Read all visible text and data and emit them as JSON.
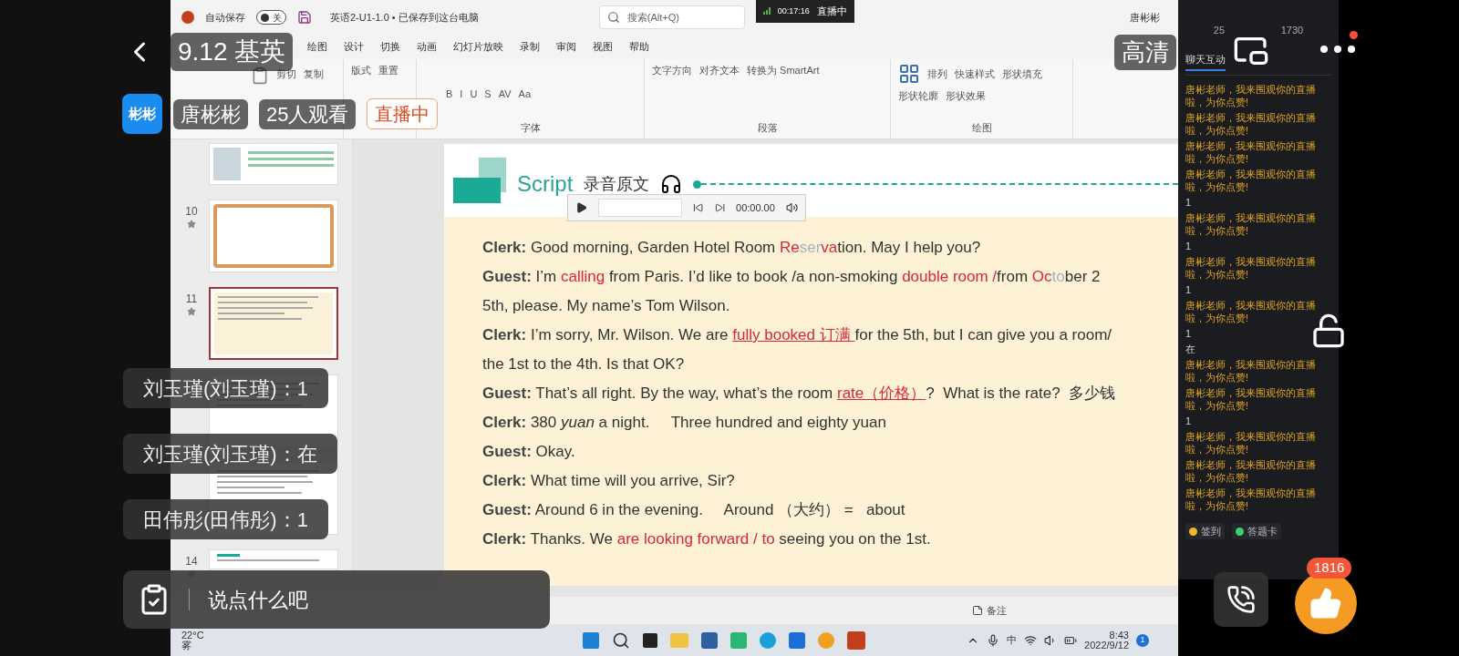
{
  "stream": {
    "title": "9.12 基英",
    "quality": "高清",
    "host_avatar": "彬彬",
    "host_name": "唐彬彬",
    "viewers": "25人观看",
    "live_badge": "直播中",
    "like_count": "1816"
  },
  "overlay_comments": [
    {
      "text": "刘玉瑾(刘玉瑾)：1"
    },
    {
      "text": "刘玉瑾(刘玉瑾)：在"
    },
    {
      "text": "田伟彤(田伟彤)：1"
    }
  ],
  "comment_input": {
    "placeholder": "说点什么吧"
  },
  "ppt": {
    "title_bar": {
      "autosave_label": "自动保存",
      "autosave_on": false,
      "toggle_text": "关",
      "filename": "英语2-U1-1.0 • 已保存到这台电脑",
      "search_placeholder": "搜索(Alt+Q)",
      "recording_time": "00:17:16",
      "recording_label": "直播中",
      "user": "唐彬彬"
    },
    "menu": [
      "绘图",
      "设计",
      "切换",
      "动画",
      "幻灯片放映",
      "录制",
      "审阅",
      "视图",
      "帮助"
    ],
    "ribbon_groups": [
      {
        "items": [
          "剪切",
          "复制"
        ]
      },
      {
        "items": [
          "版式",
          "重置"
        ]
      },
      {
        "label": "字体",
        "items": [
          "B",
          "I",
          "U",
          "S",
          "AV",
          "Aa"
        ]
      },
      {
        "label": "段落",
        "items": [
          "文字方向",
          "对齐文本",
          "转换为 SmartArt"
        ]
      },
      {
        "label": "绘图",
        "items": [
          "排列",
          "快速样式",
          "形状填充",
          "形状轮廓",
          "形状效果"
        ]
      }
    ],
    "thumbnails": [
      {
        "selected": false,
        "kind": "picture"
      },
      {
        "number": "10",
        "selected": false,
        "kind": "form"
      },
      {
        "number": "11",
        "selected": true,
        "kind": "text"
      },
      {
        "selected": false,
        "kind": "text"
      },
      {
        "selected": false,
        "kind": "text"
      },
      {
        "number": "14",
        "selected": false,
        "kind": "top"
      }
    ],
    "slide": {
      "heading": "Script",
      "heading_cn": "录音原文",
      "player_time": "00:00.00",
      "lines": [
        {
          "speaker": "Clerk:",
          "segments": [
            {
              "text": " Good morning, Garden Hotel Room ",
              "kind": "plain"
            },
            {
              "text": "Re",
              "kind": "red"
            },
            {
              "text": "ser",
              "kind": "faded"
            },
            {
              "text": "va",
              "kind": "red"
            },
            {
              "text": "tion. May I help you?",
              "kind": "plain"
            }
          ]
        },
        {
          "speaker": "Guest:",
          "segments": [
            {
              "text": " I’m ",
              "kind": "plain"
            },
            {
              "text": "calling",
              "kind": "red"
            },
            {
              "text": " from Paris. I’d like to book /a non-smoking ",
              "kind": "plain"
            },
            {
              "text": "double room /",
              "kind": "red"
            },
            {
              "text": "from ",
              "kind": "plain"
            },
            {
              "text": "Oc",
              "kind": "red"
            },
            {
              "text": "to",
              "kind": "faded"
            },
            {
              "text": "ber 2",
              "kind": "plain"
            }
          ]
        },
        {
          "segments": [
            {
              "text": "5th, please. My name’s Tom Wilson.",
              "kind": "plain"
            }
          ]
        },
        {
          "speaker": "Clerk:",
          "segments": [
            {
              "text": " I’m sorry, Mr. Wilson. We are ",
              "kind": "plain"
            },
            {
              "text": "fully booked 订满 ",
              "kind": "red_underline"
            },
            {
              "text": "for the 5th, but I can give you a room/",
              "kind": "plain"
            }
          ]
        },
        {
          "segments": [
            {
              "text": "the 1st to the 4th. Is that OK?",
              "kind": "plain"
            }
          ]
        },
        {
          "speaker": "Guest:",
          "segments": [
            {
              "text": " That’s all right. By the way, what’s the room ",
              "kind": "plain"
            },
            {
              "text": "rate（价格）",
              "kind": "red_underline"
            },
            {
              "text": "?  What is the rate?  多少钱",
              "kind": "plain"
            }
          ]
        },
        {
          "speaker": "Clerk:",
          "segments": [
            {
              "text": " 380 ",
              "kind": "plain"
            },
            {
              "text": "yuan",
              "kind": "italic"
            },
            {
              "text": " a night.     Three hundred and eighty yuan",
              "kind": "plain"
            }
          ]
        },
        {
          "speaker": "Guest:",
          "segments": [
            {
              "text": " Okay.",
              "kind": "plain"
            }
          ]
        },
        {
          "speaker": "Clerk:",
          "segments": [
            {
              "text": " What time will you arrive, Sir?",
              "kind": "plain"
            }
          ]
        },
        {
          "speaker": "Guest:",
          "segments": [
            {
              "text": " Around 6 in the evening.     Around （大约） =   about",
              "kind": "plain"
            }
          ]
        },
        {
          "speaker": "Clerk:",
          "segments": [
            {
              "text": " Thanks. We ",
              "kind": "plain"
            },
            {
              "text": "are looking forward / to",
              "kind": "red"
            },
            {
              "text": " seeing you on the 1st.",
              "kind": "plain"
            }
          ]
        }
      ]
    },
    "status_bar": {
      "notes": "备注"
    },
    "taskbar": {
      "weather_temp": "22°C",
      "weather_desc": "雾",
      "ime": "中",
      "time": "8:43",
      "date": "2022/9/12",
      "notification_count": "1"
    }
  },
  "chat_panel": {
    "stats": [
      "25",
      "1730"
    ],
    "tabs": [
      {
        "label": "聊天互动",
        "selected": true
      }
    ],
    "messages": [
      {
        "kind": "greeting",
        "text": "唐彬老师，我来围观你的直播啦，为你点赞!"
      },
      {
        "kind": "greeting",
        "text": "唐彬老师，我来围观你的直播啦，为你点赞!"
      },
      {
        "kind": "greeting",
        "text": "唐彬老师，我来围观你的直播啦，为你点赞!"
      },
      {
        "kind": "greeting",
        "text": "唐彬老师，我来围观你的直播啦，为你点赞!"
      },
      {
        "kind": "reply",
        "text": "1"
      },
      {
        "kind": "greeting",
        "text": "唐彬老师，我来围观你的直播啦，为你点赞!"
      },
      {
        "kind": "reply",
        "text": "1"
      },
      {
        "kind": "greeting",
        "text": "唐彬老师，我来围观你的直播啦，为你点赞!"
      },
      {
        "kind": "reply",
        "text": "1"
      },
      {
        "kind": "greeting",
        "text": "唐彬老师，我来围观你的直播啦，为你点赞!"
      },
      {
        "kind": "reply",
        "text": "1"
      },
      {
        "kind": "reply",
        "text": "在"
      },
      {
        "kind": "greeting",
        "text": "唐彬老师，我来围观你的直播啦，为你点赞!"
      },
      {
        "kind": "greeting",
        "text": "唐彬老师，我来围观你的直播啦，为你点赞!"
      },
      {
        "kind": "reply",
        "text": "1"
      },
      {
        "kind": "greeting",
        "text": "唐彬老师，我来围观你的直播啦，为你点赞!"
      },
      {
        "kind": "greeting",
        "text": "唐彬老师，我来围观你的直播啦，为你点赞!"
      },
      {
        "kind": "greeting",
        "text": "唐彬老师，我来围观你的直播啦，为你点赞!"
      }
    ],
    "actions": [
      {
        "label": "签到",
        "color": "#f2b631"
      },
      {
        "label": "答题卡",
        "color": "#3fcf6a"
      }
    ]
  }
}
